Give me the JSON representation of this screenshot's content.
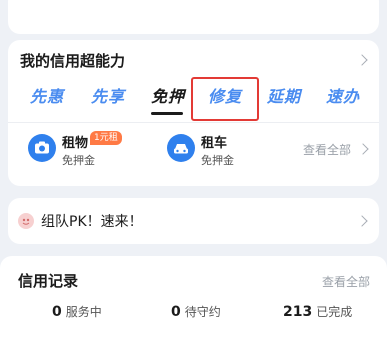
{
  "credit_ability": {
    "title": "我的信用超能力",
    "tabs": [
      {
        "label": "先惠"
      },
      {
        "label": "先享"
      },
      {
        "label": "免押"
      },
      {
        "label": "修复"
      },
      {
        "label": "延期"
      },
      {
        "label": "速办"
      }
    ],
    "active_tab": "免押",
    "highlighted_tab": "修复",
    "services": [
      {
        "name": "租物",
        "sub": "免押金",
        "badge": "1元租",
        "icon": "camera-icon"
      },
      {
        "name": "租车",
        "sub": "免押金",
        "badge": "",
        "icon": "car-icon"
      }
    ],
    "view_all": "查看全部"
  },
  "team_pk": {
    "text": "组队PK！速来！",
    "icon": "team-pk-icon"
  },
  "credit_record": {
    "title": "信用记录",
    "view_all": "查看全部",
    "stats": [
      {
        "value": "0",
        "label": "服务中"
      },
      {
        "value": "0",
        "label": "待守约"
      },
      {
        "value": "213",
        "label": "已完成"
      }
    ]
  },
  "colors": {
    "accent": "#2f80ed",
    "tab_inactive": "#4a8cf0",
    "highlight": "#e33a35",
    "badge": "#ff7a45"
  }
}
